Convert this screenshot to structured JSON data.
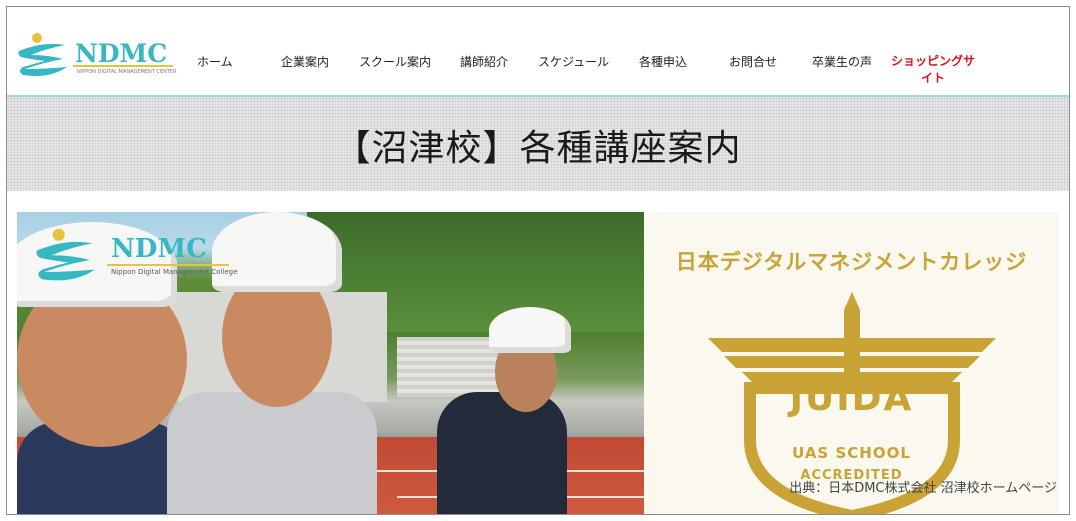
{
  "header": {
    "logo_text": "NDMC",
    "logo_subtitle": "NIPPON DIGITAL MANAGEMENT CENTER",
    "nav": [
      "ホーム",
      "企業案内",
      "スクール案内",
      "講師紹介",
      "スケジュール",
      "各種申込",
      "お問合せ",
      "卒業生の声"
    ],
    "shop_line1": "ショッピングサ",
    "shop_line2": "イト"
  },
  "band": {
    "title": "【沼津校】各種講座案内"
  },
  "banner": {
    "logo_text": "NDMC",
    "logo_subtitle": "Nippon Digital Management College"
  },
  "panel": {
    "title": "日本デジタルマネジメントカレッジ",
    "badge_main": "JUIDA",
    "badge_line1": "UAS SCHOOL",
    "badge_line2": "ACCREDITED"
  },
  "credit": "出典：日本DMC株式会社 沼津校ホームページ",
  "colors": {
    "brand_teal": "#35b8c2",
    "gold": "#c9a335",
    "shop_red": "#e0101a",
    "rule": "#9ed8e0"
  }
}
